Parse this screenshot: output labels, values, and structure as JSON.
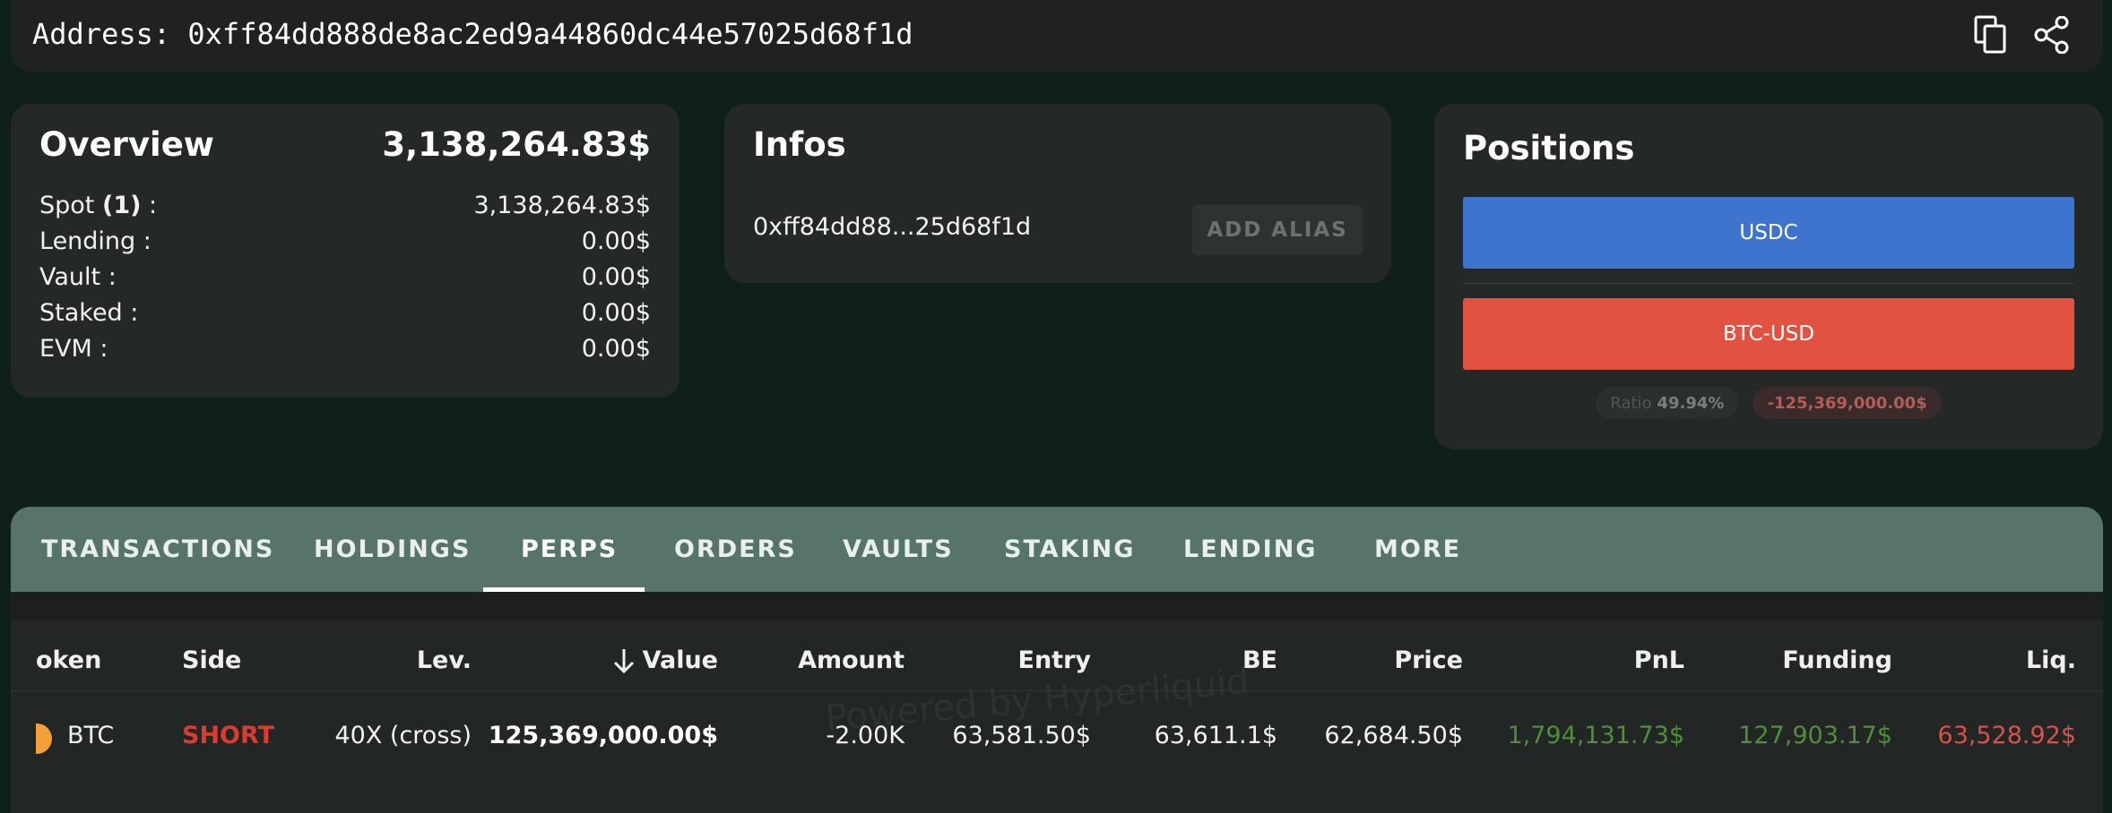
{
  "address": {
    "label": "Address:",
    "value": "0xff84dd888de8ac2ed9a44860dc44e57025d68f1d"
  },
  "overview": {
    "title": "Overview",
    "total": "3,138,264.83$",
    "rows": [
      {
        "label": "Spot",
        "count": "(1)",
        "suffix": " :",
        "value": "3,138,264.83$"
      },
      {
        "label": "Lending :",
        "value": "0.00$"
      },
      {
        "label": "Vault :",
        "value": "0.00$"
      },
      {
        "label": "Staked :",
        "value": "0.00$"
      },
      {
        "label": "EVM :",
        "value": "0.00$"
      }
    ]
  },
  "infos": {
    "title": "Infos",
    "short_address": "0xff84dd88...25d68f1d",
    "add_alias": "ADD ALIAS"
  },
  "positions": {
    "title": "Positions",
    "bars": [
      {
        "label": "USDC",
        "color": "#3e74cd"
      },
      {
        "label": "BTC-USD",
        "color": "#e25241"
      }
    ],
    "ratio_label": "Ratio",
    "ratio_value": "49.94%",
    "net_value": "-125,369,000.00$"
  },
  "tabs": [
    "TRANSACTIONS",
    "HOLDINGS",
    "PERPS",
    "ORDERS",
    "VAULTS",
    "STAKING",
    "LENDING",
    "MORE"
  ],
  "active_tab": "PERPS",
  "table": {
    "headers": {
      "token": "oken",
      "side": "Side",
      "lev": "Lev.",
      "value": "Value",
      "amount": "Amount",
      "entry": "Entry",
      "be": "BE",
      "price": "Price",
      "pnl": "PnL",
      "funding": "Funding",
      "liq": "Liq."
    },
    "watermark": "Powered by Hyperliquid",
    "rows": [
      {
        "token": "BTC",
        "side": "SHORT",
        "lev": "40X (cross)",
        "value": "125,369,000.00$",
        "amount": "-2.00K",
        "entry": "63,581.50$",
        "be": "63,611.1$",
        "price": "62,684.50$",
        "pnl": "1,794,131.73$",
        "funding": "127,903.17$",
        "liq": "63,528.92$"
      }
    ]
  },
  "colors": {
    "positive": "#4f8f3c",
    "negative": "#d9524a",
    "short": "#e03a2e",
    "tabs_bg": "#56746b"
  },
  "icons": [
    "copy-icon",
    "share-icon",
    "sort-down-icon",
    "btc-coin-icon"
  ]
}
